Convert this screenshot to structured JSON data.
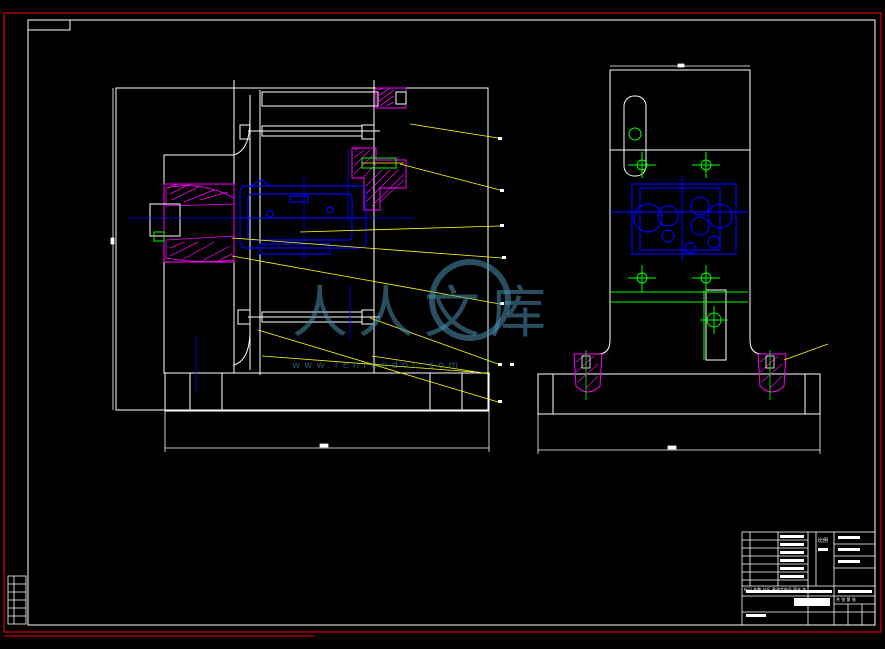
{
  "drawing": {
    "colors": {
      "background": "#000000",
      "frame": "#ff0000",
      "outline": "#ffffff",
      "part": "#0000ff",
      "leader": "#ffff00",
      "dimension": "#00ff00",
      "hatch": "#ff00ff",
      "watermark": "#4a8fb0"
    },
    "watermark": {
      "text": "人人文库",
      "url": "www.renrendoc.com"
    },
    "front_view": {
      "leader_count": 9
    },
    "side_view": {
      "leader_count": 1
    },
    "title_block": {
      "columns_label": "标记 处数 分区 更改文件号 签名 年月日",
      "scale_label": "比例",
      "sheet_label": "共 张 第 张"
    }
  }
}
